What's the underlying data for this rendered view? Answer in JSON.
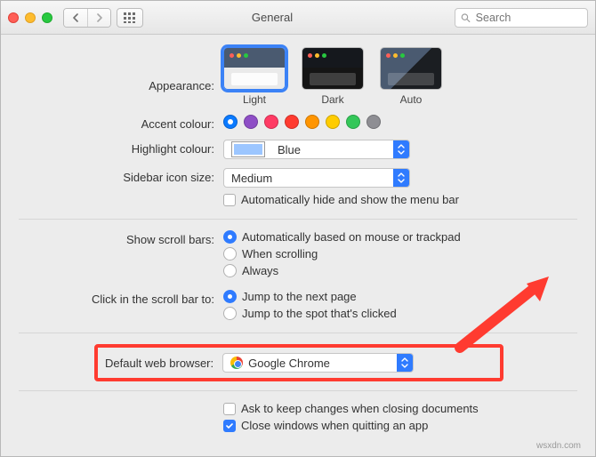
{
  "window": {
    "title": "General"
  },
  "toolbar": {
    "search_placeholder": "Search"
  },
  "appearance": {
    "label": "Appearance:",
    "options": [
      {
        "label": "Light",
        "selected": true
      },
      {
        "label": "Dark",
        "selected": false
      },
      {
        "label": "Auto",
        "selected": false
      }
    ]
  },
  "accent": {
    "label": "Accent colour:",
    "colors": [
      "#0a7aff",
      "#8e4ec6",
      "#ff3b64",
      "#ff3b30",
      "#ff9500",
      "#ffcc00",
      "#34c759",
      "#8e8e93"
    ],
    "selected_index": 0
  },
  "highlight": {
    "label": "Highlight colour:",
    "value": "Blue"
  },
  "sidebar_size": {
    "label": "Sidebar icon size:",
    "value": "Medium"
  },
  "menubar_hide": {
    "label": "Automatically hide and show the menu bar",
    "checked": false
  },
  "scrollbars": {
    "label": "Show scroll bars:",
    "options": [
      {
        "label": "Automatically based on mouse or trackpad",
        "checked": true
      },
      {
        "label": "When scrolling",
        "checked": false
      },
      {
        "label": "Always",
        "checked": false
      }
    ]
  },
  "scrollclick": {
    "label": "Click in the scroll bar to:",
    "options": [
      {
        "label": "Jump to the next page",
        "checked": true
      },
      {
        "label": "Jump to the spot that's clicked",
        "checked": false
      }
    ]
  },
  "browser": {
    "label": "Default web browser:",
    "value": "Google Chrome",
    "icon": "chrome-icon"
  },
  "closing": {
    "ask": {
      "label": "Ask to keep changes when closing documents",
      "checked": false
    },
    "close_windows": {
      "label": "Close windows when quitting an app",
      "checked": true
    }
  },
  "watermark": "wsxdn.com"
}
